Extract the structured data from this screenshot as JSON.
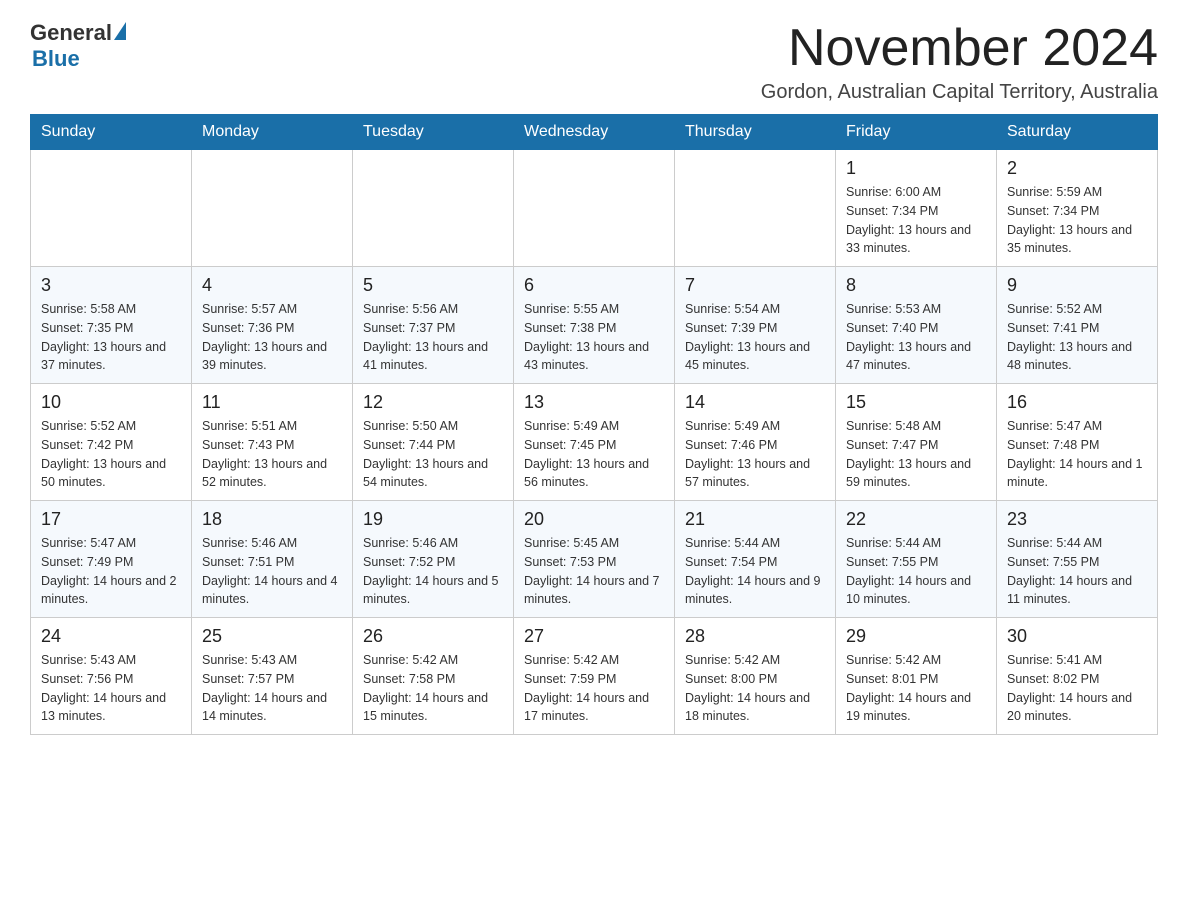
{
  "logo": {
    "general_text": "General",
    "blue_text": "Blue"
  },
  "title": "November 2024",
  "location": "Gordon, Australian Capital Territory, Australia",
  "weekdays": [
    "Sunday",
    "Monday",
    "Tuesday",
    "Wednesday",
    "Thursday",
    "Friday",
    "Saturday"
  ],
  "weeks": [
    [
      {
        "day": "",
        "sunrise": "",
        "sunset": "",
        "daylight": ""
      },
      {
        "day": "",
        "sunrise": "",
        "sunset": "",
        "daylight": ""
      },
      {
        "day": "",
        "sunrise": "",
        "sunset": "",
        "daylight": ""
      },
      {
        "day": "",
        "sunrise": "",
        "sunset": "",
        "daylight": ""
      },
      {
        "day": "",
        "sunrise": "",
        "sunset": "",
        "daylight": ""
      },
      {
        "day": "1",
        "sunrise": "Sunrise: 6:00 AM",
        "sunset": "Sunset: 7:34 PM",
        "daylight": "Daylight: 13 hours and 33 minutes."
      },
      {
        "day": "2",
        "sunrise": "Sunrise: 5:59 AM",
        "sunset": "Sunset: 7:34 PM",
        "daylight": "Daylight: 13 hours and 35 minutes."
      }
    ],
    [
      {
        "day": "3",
        "sunrise": "Sunrise: 5:58 AM",
        "sunset": "Sunset: 7:35 PM",
        "daylight": "Daylight: 13 hours and 37 minutes."
      },
      {
        "day": "4",
        "sunrise": "Sunrise: 5:57 AM",
        "sunset": "Sunset: 7:36 PM",
        "daylight": "Daylight: 13 hours and 39 minutes."
      },
      {
        "day": "5",
        "sunrise": "Sunrise: 5:56 AM",
        "sunset": "Sunset: 7:37 PM",
        "daylight": "Daylight: 13 hours and 41 minutes."
      },
      {
        "day": "6",
        "sunrise": "Sunrise: 5:55 AM",
        "sunset": "Sunset: 7:38 PM",
        "daylight": "Daylight: 13 hours and 43 minutes."
      },
      {
        "day": "7",
        "sunrise": "Sunrise: 5:54 AM",
        "sunset": "Sunset: 7:39 PM",
        "daylight": "Daylight: 13 hours and 45 minutes."
      },
      {
        "day": "8",
        "sunrise": "Sunrise: 5:53 AM",
        "sunset": "Sunset: 7:40 PM",
        "daylight": "Daylight: 13 hours and 47 minutes."
      },
      {
        "day": "9",
        "sunrise": "Sunrise: 5:52 AM",
        "sunset": "Sunset: 7:41 PM",
        "daylight": "Daylight: 13 hours and 48 minutes."
      }
    ],
    [
      {
        "day": "10",
        "sunrise": "Sunrise: 5:52 AM",
        "sunset": "Sunset: 7:42 PM",
        "daylight": "Daylight: 13 hours and 50 minutes."
      },
      {
        "day": "11",
        "sunrise": "Sunrise: 5:51 AM",
        "sunset": "Sunset: 7:43 PM",
        "daylight": "Daylight: 13 hours and 52 minutes."
      },
      {
        "day": "12",
        "sunrise": "Sunrise: 5:50 AM",
        "sunset": "Sunset: 7:44 PM",
        "daylight": "Daylight: 13 hours and 54 minutes."
      },
      {
        "day": "13",
        "sunrise": "Sunrise: 5:49 AM",
        "sunset": "Sunset: 7:45 PM",
        "daylight": "Daylight: 13 hours and 56 minutes."
      },
      {
        "day": "14",
        "sunrise": "Sunrise: 5:49 AM",
        "sunset": "Sunset: 7:46 PM",
        "daylight": "Daylight: 13 hours and 57 minutes."
      },
      {
        "day": "15",
        "sunrise": "Sunrise: 5:48 AM",
        "sunset": "Sunset: 7:47 PM",
        "daylight": "Daylight: 13 hours and 59 minutes."
      },
      {
        "day": "16",
        "sunrise": "Sunrise: 5:47 AM",
        "sunset": "Sunset: 7:48 PM",
        "daylight": "Daylight: 14 hours and 1 minute."
      }
    ],
    [
      {
        "day": "17",
        "sunrise": "Sunrise: 5:47 AM",
        "sunset": "Sunset: 7:49 PM",
        "daylight": "Daylight: 14 hours and 2 minutes."
      },
      {
        "day": "18",
        "sunrise": "Sunrise: 5:46 AM",
        "sunset": "Sunset: 7:51 PM",
        "daylight": "Daylight: 14 hours and 4 minutes."
      },
      {
        "day": "19",
        "sunrise": "Sunrise: 5:46 AM",
        "sunset": "Sunset: 7:52 PM",
        "daylight": "Daylight: 14 hours and 5 minutes."
      },
      {
        "day": "20",
        "sunrise": "Sunrise: 5:45 AM",
        "sunset": "Sunset: 7:53 PM",
        "daylight": "Daylight: 14 hours and 7 minutes."
      },
      {
        "day": "21",
        "sunrise": "Sunrise: 5:44 AM",
        "sunset": "Sunset: 7:54 PM",
        "daylight": "Daylight: 14 hours and 9 minutes."
      },
      {
        "day": "22",
        "sunrise": "Sunrise: 5:44 AM",
        "sunset": "Sunset: 7:55 PM",
        "daylight": "Daylight: 14 hours and 10 minutes."
      },
      {
        "day": "23",
        "sunrise": "Sunrise: 5:44 AM",
        "sunset": "Sunset: 7:55 PM",
        "daylight": "Daylight: 14 hours and 11 minutes."
      }
    ],
    [
      {
        "day": "24",
        "sunrise": "Sunrise: 5:43 AM",
        "sunset": "Sunset: 7:56 PM",
        "daylight": "Daylight: 14 hours and 13 minutes."
      },
      {
        "day": "25",
        "sunrise": "Sunrise: 5:43 AM",
        "sunset": "Sunset: 7:57 PM",
        "daylight": "Daylight: 14 hours and 14 minutes."
      },
      {
        "day": "26",
        "sunrise": "Sunrise: 5:42 AM",
        "sunset": "Sunset: 7:58 PM",
        "daylight": "Daylight: 14 hours and 15 minutes."
      },
      {
        "day": "27",
        "sunrise": "Sunrise: 5:42 AM",
        "sunset": "Sunset: 7:59 PM",
        "daylight": "Daylight: 14 hours and 17 minutes."
      },
      {
        "day": "28",
        "sunrise": "Sunrise: 5:42 AM",
        "sunset": "Sunset: 8:00 PM",
        "daylight": "Daylight: 14 hours and 18 minutes."
      },
      {
        "day": "29",
        "sunrise": "Sunrise: 5:42 AM",
        "sunset": "Sunset: 8:01 PM",
        "daylight": "Daylight: 14 hours and 19 minutes."
      },
      {
        "day": "30",
        "sunrise": "Sunrise: 5:41 AM",
        "sunset": "Sunset: 8:02 PM",
        "daylight": "Daylight: 14 hours and 20 minutes."
      }
    ]
  ]
}
